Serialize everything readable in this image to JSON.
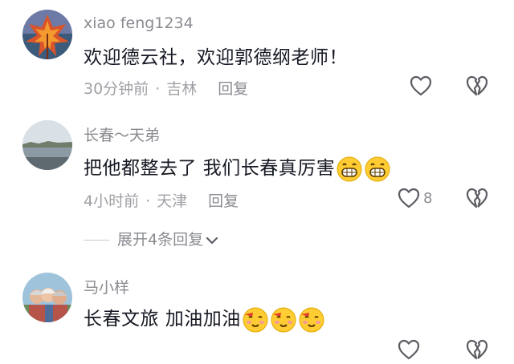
{
  "comments": [
    {
      "username": "xiao feng1234",
      "text": "欢迎德云社，欢迎郭德纲老师！",
      "time": "30分钟前",
      "location": "吉林",
      "reply_label": "回复",
      "like_count": "",
      "avatar": "maple-leaf-avatar"
    },
    {
      "username": "长春～天弟",
      "text": "把他都整去了  我们长春真厉害",
      "time": "4小时前",
      "location": "天津",
      "reply_label": "回复",
      "like_count": "8",
      "avatar": "lake-landscape-avatar"
    },
    {
      "username": "马小样",
      "text": "长春文旅  加油加油",
      "time": "",
      "location": "",
      "reply_label": "",
      "like_count": "",
      "avatar": "group-photo-avatar"
    }
  ],
  "expand_replies": {
    "label": "展开4条回复",
    "icon": "chevron-down-icon"
  },
  "separator": "·",
  "icons": {
    "like": "heart-outline-icon",
    "dislike": "broken-heart-icon"
  },
  "colors": {
    "username": "#8a8b91",
    "text": "#161823",
    "meta": "#9fa0a5",
    "background": "#ffffff"
  }
}
